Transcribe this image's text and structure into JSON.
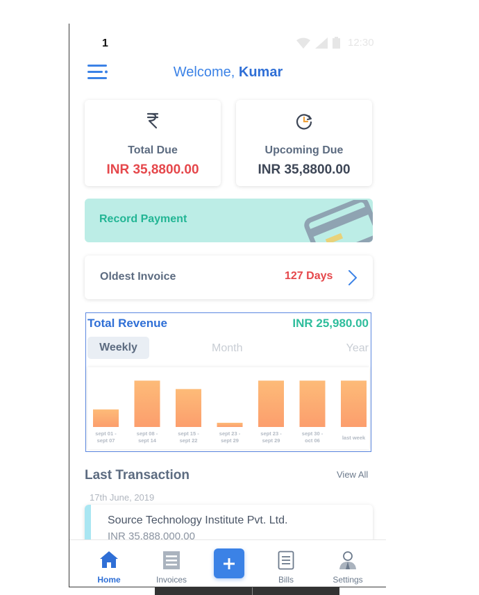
{
  "status_bar": {
    "number": "1",
    "time": "12:30"
  },
  "header": {
    "greeting": "Welcome, ",
    "user_name": "Kumar"
  },
  "due_cards": {
    "total": {
      "label": "Total Due",
      "amount": "INR 35,8800.00",
      "icon": "rupee-icon"
    },
    "upcoming": {
      "label": "Upcoming Due",
      "amount": "INR 35,8800.00",
      "icon": "clock-icon"
    }
  },
  "record_payment": {
    "label": "Record Payment"
  },
  "oldest_invoice": {
    "label": "Oldest Invoice",
    "days": "127 Days"
  },
  "revenue": {
    "title": "Total Revenue",
    "amount": "INR 25,980.00",
    "tabs": [
      "Weekly",
      "Month",
      "Year"
    ],
    "active_tab": "Weekly"
  },
  "chart_data": {
    "type": "bar",
    "categories": [
      [
        "sept 01 -",
        "sept 07"
      ],
      [
        "sept 08 -",
        "sept 14"
      ],
      [
        "sept 15 -",
        "sept 22"
      ],
      [
        "sept 23 -",
        "sept 29"
      ],
      [
        "sept 23 -",
        "sept 29"
      ],
      [
        "sept 30 -",
        "oct 06"
      ],
      [
        "last week"
      ]
    ],
    "values": [
      25,
      66,
      54,
      6,
      66,
      66,
      66
    ],
    "ylim": [
      0,
      85
    ],
    "grid": false,
    "colors": {
      "top": "#fdbb78",
      "bottom": "#fc9e6d"
    }
  },
  "last_transaction": {
    "title": "Last Transaction",
    "view_all": "View All",
    "date": "17th June, 2019",
    "items": [
      {
        "name": "Source Technology Institute Pvt. Ltd.",
        "amount": "INR 35,888,000.00"
      }
    ]
  },
  "bottom_nav": {
    "items": [
      {
        "label": "Home",
        "icon": "home-icon",
        "active": true
      },
      {
        "label": "Invoices",
        "icon": "invoice-icon",
        "active": false
      },
      {
        "label": "Bills",
        "icon": "bill-icon",
        "active": false
      },
      {
        "label": "Settings",
        "icon": "user-settings-icon",
        "active": false
      }
    ],
    "fab_icon": "plus-icon"
  },
  "colors": {
    "primary": "#3b82e6",
    "danger": "#e5474b",
    "success": "#2ebd9c",
    "record_bg": "#bcede6"
  }
}
